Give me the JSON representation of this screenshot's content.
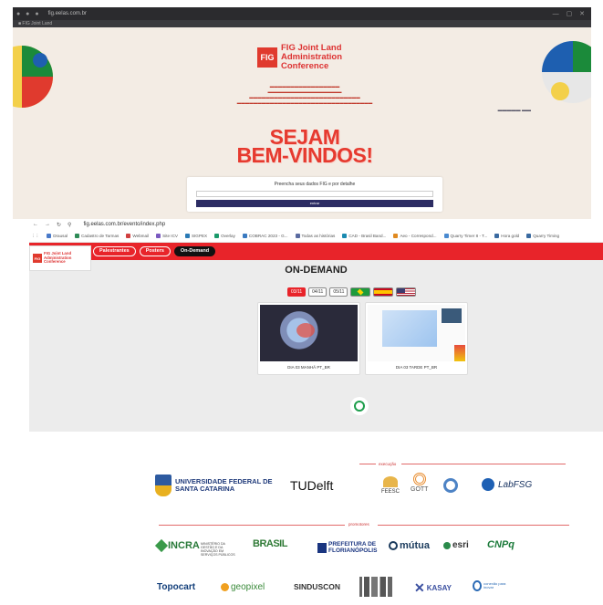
{
  "landing": {
    "event_title": "FIG Joint Land Administration Conference",
    "fig_mark": "FIG",
    "welcome_line1": "SEJAM",
    "welcome_line2": "BEM-VINDOS!",
    "login_prompt": "Preencha seus dados FIG e por detalhe",
    "email_placeholder": "",
    "enter_button": "entrar"
  },
  "browser": {
    "url": "fig.eelas.com.br/evento/index.php",
    "bookmarks": [
      {
        "label": "Drausal",
        "color": "#4a7ac9"
      },
      {
        "label": "Cadastro de Tarmas",
        "color": "#2e8b57"
      },
      {
        "label": "Webmail",
        "color": "#d04040"
      },
      {
        "label": "Site ICV",
        "color": "#7a5ac0"
      },
      {
        "label": "SIGPEX",
        "color": "#2a7ab5"
      },
      {
        "label": "Overlay",
        "color": "#1a9a6a"
      },
      {
        "label": "COBRAC 2023 - G...",
        "color": "#3a7ac0"
      },
      {
        "label": "Todas as histórias",
        "color": "#5a6aa0"
      },
      {
        "label": "CAD - Brasil Band...",
        "color": "#1a8ab0"
      },
      {
        "label": "Aeo - Correspond...",
        "color": "#e08a20"
      },
      {
        "label": "Quarry Timer 8 - T...",
        "color": "#4a8ad0"
      },
      {
        "label": "Hora gold",
        "color": "#3a6aa0"
      },
      {
        "label": "Quarry Timing",
        "color": "#3a6aa0"
      }
    ]
  },
  "header": {
    "logo_mark": "FIG",
    "logo_text": "FIG Joint Land Administration Conference",
    "nav": [
      "Palestrantes",
      "Posters",
      "On-Demand"
    ],
    "active_nav": "On-Demand"
  },
  "ondemand": {
    "title": "ON-DEMAND",
    "dates": [
      "03/11",
      "04/11",
      "05/11"
    ],
    "active_date": "03/11",
    "languages": [
      "pt",
      "es",
      "en"
    ],
    "videos": [
      {
        "caption": "DIA 03 MANHÃ PT_BR"
      },
      {
        "caption": "DIA 03 TARDE PT_BR"
      }
    ]
  },
  "partners": {
    "execution_label": "execução",
    "promoters_label": "promotores",
    "ufsc": "UNIVERSIDADE FEDERAL DE SANTA CATARINA",
    "tudelft": "TUDelft",
    "feesc": "FEESC",
    "gott": "GOTT",
    "labfsg": "LabFSG",
    "incra": "INCRA",
    "gov_text": "MINISTÉRIO DA GESTÃO E DA INOVAÇÃO EM SERVIÇOS PÚBLICOS",
    "brasil": "BRASIL",
    "pmf": "PREFEITURA DE FLORIANÓPOLIS",
    "mutua": "mútua",
    "esri": "esri",
    "cnpq": "CNPq",
    "topocart": "Topocart",
    "geopixel": "geopixel",
    "sinduscon": "SINDUSCON",
    "kasay": "KASAY",
    "conexao": "conexão para inovar"
  },
  "colors": {
    "brand_red": "#e8242a",
    "navy": "#2c2c63",
    "whatsapp_green": "#1e9e4c"
  }
}
